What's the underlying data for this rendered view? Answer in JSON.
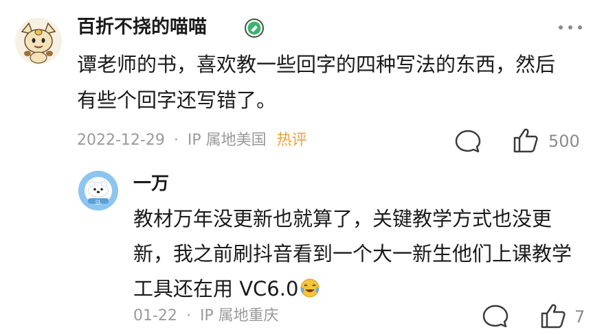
{
  "comment": {
    "username": "百折不挠的喵喵",
    "text": "谭老师的书，喜欢教一些回字的四种写法的东西，然后有些个回字还写错了。",
    "date": "2022-12-29",
    "separator": "·",
    "ip_location": "IP 属地美国",
    "hot_tag": "热评",
    "like_count": "500",
    "avatar_icon": "meowth-avatar",
    "badge_icon": "green-verified-badge",
    "more_icon": "more-dots-icon"
  },
  "reply": {
    "username": "一万",
    "text": "教材万年没更新也就算了，关键教学方式也没更新，我之前刷抖音看到一个大一新生他们上课教学工具还在用 VC6.0",
    "emoji_icon": "laughing-crying-emoji",
    "date": "01-22",
    "separator": "·",
    "ip_location": "IP 属地重庆",
    "like_count": "7",
    "avatar_icon": "polar-bear-avatar"
  },
  "colors": {
    "hot_tag": "#e8a23a",
    "meta_gray": "#9a9a9a",
    "badge_green": "#3cb371"
  }
}
